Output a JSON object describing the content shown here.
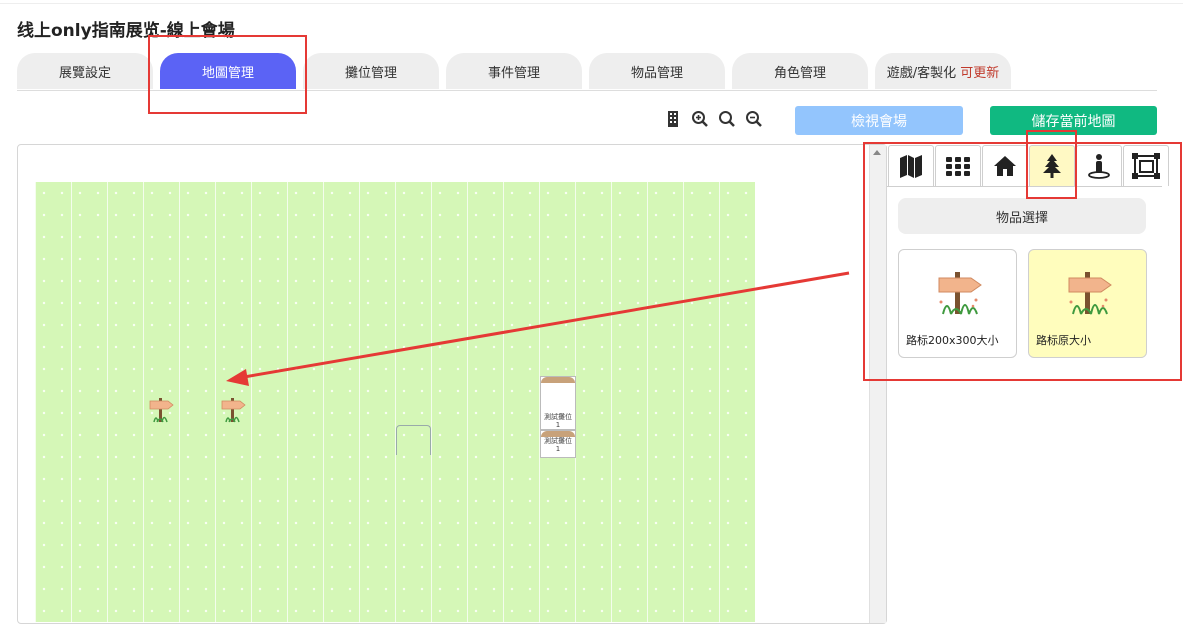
{
  "page": {
    "title": "线上only指南展览-線上會場"
  },
  "tabs": [
    {
      "label": "展覽設定",
      "active": false
    },
    {
      "label": "地圖管理",
      "active": true
    },
    {
      "label": "攤位管理",
      "active": false
    },
    {
      "label": "事件管理",
      "active": false
    },
    {
      "label": "物品管理",
      "active": false
    },
    {
      "label": "角色管理",
      "active": false
    },
    {
      "label": "遊戲/客製化",
      "note": "可更新",
      "active": false
    }
  ],
  "toolbar": {
    "icons": [
      "building-icon",
      "zoom-in-icon",
      "zoom-reset-icon",
      "zoom-out-icon"
    ],
    "view_label": "檢視會場",
    "save_label": "儲存當前地圖"
  },
  "canvas": {
    "booths": [
      {
        "label": "測試攤位",
        "number": "1"
      },
      {
        "label": "測試攤位",
        "number": "1"
      }
    ]
  },
  "panel": {
    "tabs": [
      "map-icon",
      "grid-icon",
      "home-icon",
      "tree-icon",
      "character-icon",
      "frame-icon"
    ],
    "active_tab": "tree-icon",
    "section_title": "物品選擇",
    "items": [
      {
        "label": "路标200x300大小",
        "selected": false
      },
      {
        "label": "路标原大小",
        "selected": true
      }
    ]
  },
  "colors": {
    "accent": "#5b63f5",
    "grass": "#d5f7b7",
    "view_button": "#93c5fd",
    "save_button": "#10b981",
    "highlight": "#e53935",
    "selected_item": "#fffdbd"
  }
}
